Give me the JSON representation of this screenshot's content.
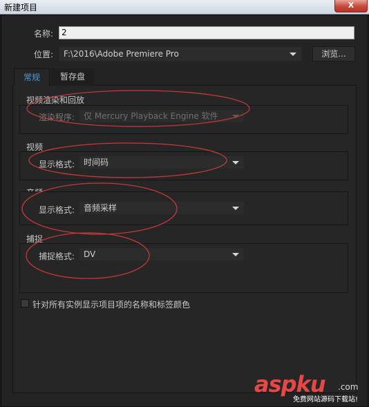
{
  "window": {
    "title": "新建项目",
    "close": "X"
  },
  "form": {
    "name_label": "名称:",
    "name_value": "2",
    "location_label": "位置:",
    "location_value": "F:\\2016\\Adobe Premiere Pro",
    "browse_label": "浏览..."
  },
  "tabs": [
    {
      "label": "常规",
      "active": true
    },
    {
      "label": "暂存盘",
      "active": false
    }
  ],
  "groups": {
    "render": {
      "title": "视频渲染和回放",
      "label": "渲染程序:",
      "value": "仅 Mercury Playback Engine 软件",
      "disabled": true
    },
    "video": {
      "title": "视频",
      "label": "显示格式:",
      "value": "时间码"
    },
    "audio": {
      "title": "音频",
      "label": "显示格式:",
      "value": "音频采样"
    },
    "capture": {
      "title": "捕捉",
      "label": "捕捉格式:",
      "value": "DV"
    }
  },
  "checkbox": {
    "label": "针对所有实例显示项目项的名称和标签颜色",
    "checked": false
  },
  "watermark": {
    "main": "aspku",
    "suffix": ".com",
    "sub": "免费网站源码下载站!"
  },
  "colors": {
    "accent_tab": "#4e9ad9",
    "annotation": "#c23a3a",
    "watermark": "#e64848"
  }
}
